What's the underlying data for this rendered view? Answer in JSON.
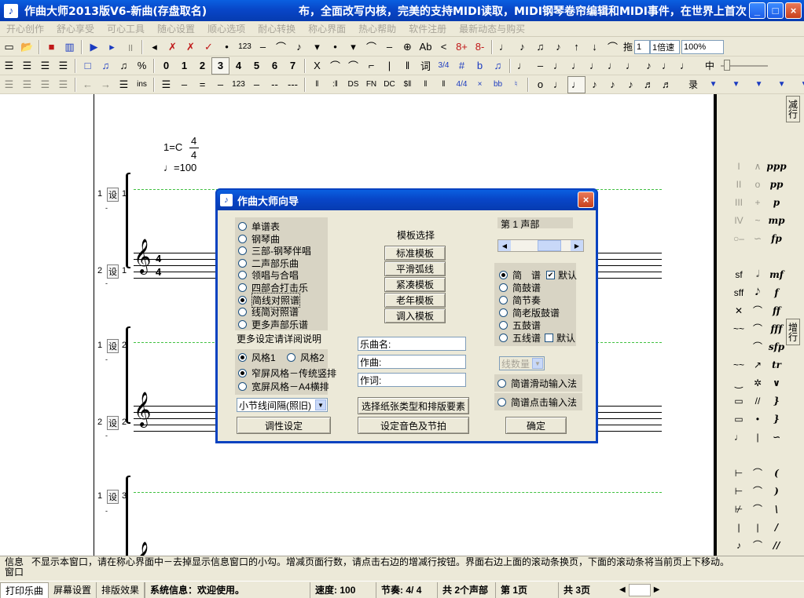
{
  "window": {
    "title": "作曲大师2013版V6-新曲(存盘取名)",
    "marquee": "布，全面改写内核，完美的支持MIDI读取，MIDI钢琴卷帘编辑和MIDI事件，在世界上首次",
    "min_label": "_",
    "max_label": "□",
    "close_label": "×",
    "icon_glyph": "♪"
  },
  "menubar": {
    "items": [
      "开心创作",
      "舒心享受",
      "可心工具",
      "随心设置",
      "顺心选项",
      "耐心转换",
      "称心界面",
      "热心帮助",
      "软件注册",
      "最新动态与购买"
    ]
  },
  "toolbar1": {
    "left_icons": [
      "new-file-icon",
      "open-folder-icon",
      "stop-icon",
      "piano-icon",
      "play-icon",
      "play-step-icon",
      "pause-icon"
    ],
    "left_glyphs": [
      "▭",
      "📂",
      "■",
      "▥",
      "▶",
      "▸",
      "॥"
    ],
    "middle_glyphs": [
      "◂",
      "✗",
      "✗",
      "✓",
      "•",
      "123",
      "–",
      "⌒",
      "♪",
      "▾",
      "•",
      "▾",
      "⌒",
      "–",
      "⊕",
      "Ab",
      "<",
      "8+",
      "8-"
    ],
    "right_glyphs": [
      "♩",
      "♪",
      "♫",
      "♪",
      "↑",
      "↓",
      "⌒"
    ],
    "drag_label": "拖",
    "drag_value": "1",
    "speed_value": "1倍速",
    "zoom_value": "100%"
  },
  "toolbar2": {
    "left_glyphs": [
      "☰",
      "☰",
      "☰",
      "☰",
      "□",
      "♫",
      "♫",
      "%"
    ],
    "digits": [
      "0",
      "1",
      "2",
      "3",
      "4",
      "5",
      "6",
      "7"
    ],
    "pressed_digit": "3",
    "middle_glyphs": [
      "X",
      "⌒",
      "⌒",
      "⌐",
      "|",
      "‖",
      "词",
      "3/4",
      "#",
      "b",
      "♫"
    ],
    "right_glyphs": [
      "♩",
      "–",
      "♩",
      "♩",
      "♩",
      "♩",
      "♩",
      "♪",
      "♩",
      "♩"
    ],
    "mid_label": "中"
  },
  "toolbar3": {
    "left_glyphs": [
      "☰",
      "☰",
      "☰",
      "☰",
      "←",
      "→",
      "☰",
      "ins",
      "☰",
      "–",
      "=",
      "–",
      "123",
      "–",
      "--",
      "---"
    ],
    "middle_glyphs": [
      "‖",
      ":‖",
      "DS",
      "FN",
      "DC",
      "$‖",
      "‖",
      "‖",
      "4/4",
      "×",
      "bb",
      "♮"
    ],
    "right_glyphs": [
      "o",
      "♩",
      "♩",
      "♪",
      "♪",
      "♪",
      "♬",
      "♬"
    ],
    "record_label": "录"
  },
  "score": {
    "key": "1=C",
    "time_top": "4",
    "time_bottom": "4",
    "tempo": "♩=100",
    "rows": [
      {
        "num": "1",
        "tag": "设",
        "measure": "1"
      },
      {
        "num": "2",
        "tag": "设",
        "measure": "1"
      },
      {
        "num": "1",
        "tag": "设",
        "measure": "2"
      },
      {
        "num": "2",
        "tag": "设",
        "measure": "2"
      },
      {
        "num": "1",
        "tag": "设",
        "measure": "3"
      }
    ],
    "clef": "𝄞",
    "staff_ts_top": "4",
    "staff_ts_bottom": "4"
  },
  "palette": {
    "col1": [
      "I",
      "II",
      "III",
      "IV",
      "○–",
      "",
      "sf",
      "sff",
      "✕",
      "~~",
      "",
      "~~",
      "‿",
      "▭",
      "▭",
      "♩",
      "",
      "⊢",
      "⊢",
      "⊬",
      "|",
      "♪"
    ],
    "col2": [
      "∧",
      "o",
      "+",
      "~",
      "∽",
      "",
      "𝅗𝅥",
      "𝅘𝅥𝅮",
      "⌒",
      "⌒",
      "⌒",
      "↗",
      "✲",
      "//",
      "•",
      "|",
      "",
      "⌒",
      "⌒",
      "⌒",
      "|",
      "⌒"
    ],
    "col3": [
      "ppp",
      "pp",
      "p",
      "mp",
      "fp",
      "",
      "mf",
      "f",
      "ff",
      "fff",
      "sfp",
      "tr",
      "∨",
      "}",
      "}",
      "∽",
      "",
      "(",
      ")",
      "\\",
      "/",
      "//"
    ],
    "reduce_row_label": "减行",
    "add_row_label": "增行"
  },
  "infobar": {
    "label": "信息窗口",
    "text": "不显示本窗口，请在称心界面中－去掉显示信息窗口的小勾。增减页面行数，请点击右边的增减行按钮。界面右边上面的滚动条换页，下面的滚动条将当前页上下移动。"
  },
  "statusbar": {
    "tabs": [
      "打印乐曲",
      "屏幕设置",
      "排版效果"
    ],
    "system": "系统信息：欢迎使用。",
    "speed": "速度: 100",
    "beat": "节奏: 4/ 4",
    "voices": "共 2个声部",
    "page": "第 1页",
    "pages": "共 3页"
  },
  "dialog": {
    "title": "作曲大师向导",
    "close_label": "×",
    "score_types": [
      "单谱表",
      "钢琴曲",
      "三部-钢琴伴唱",
      "二声部乐曲",
      "领唱与合唱",
      "四部合打击乐",
      "简线对照谱",
      "线简对照谱",
      "更多声部乐谱"
    ],
    "score_selected_index": 6,
    "more_note": "更多设定请详阅说明",
    "style1": "风格1",
    "style2": "风格2",
    "narrow": "窄屏风格－传统竖排",
    "wide": "宽屏风格－A4横排",
    "barline_combo": "小节线间隔(照旧)",
    "key_button": "调性设定",
    "template_title": "模板选择",
    "template_buttons": [
      "标准模板",
      "平滑弧线",
      "紧凑模板",
      "老年模板",
      "调入模板"
    ],
    "song_name_label": "乐曲名:",
    "composer_label": "作曲:",
    "lyricist_label": "作词:",
    "paper_button": "选择纸张类型和排版要素",
    "timbre_button": "设定音色及节拍",
    "voice_label": "第 1 声部",
    "notation_types": [
      "简　谱",
      "简鼓谱",
      "简节奏",
      "简老版鼓谱",
      "五鼓谱",
      "五线谱"
    ],
    "notation_selected_index": 0,
    "default_label": "默认",
    "default_checked": true,
    "line_count_combo": "线数量",
    "slide_input": "简谱滑动输入法",
    "click_input": "简谱点击输入法",
    "ok_button": "确定"
  }
}
